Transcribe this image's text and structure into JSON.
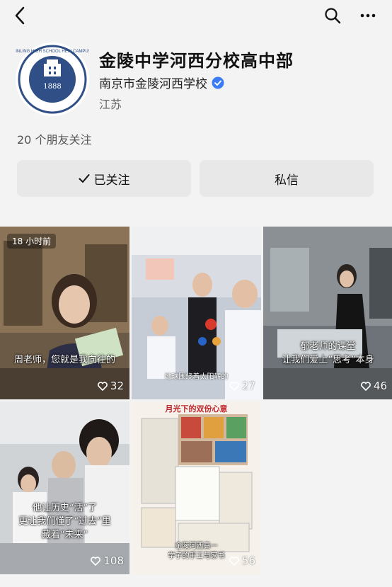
{
  "profile": {
    "name": "金陵中学河西分校高中部",
    "organization": "南京市金陵河西学校",
    "region": "江苏",
    "friends_following": "20 个朋友关注",
    "logo_text": "金陵中学"
  },
  "actions": {
    "follow_label": "已关注",
    "message_label": "私信"
  },
  "videos": [
    {
      "time": "18 小时前",
      "caption": "周老师，您就是我向往的",
      "likes": "32"
    },
    {
      "subcaption": "地球围绕着太阳转的",
      "likes": "27"
    },
    {
      "caption": "郁老师的课堂\n让我们爱上“思考”本身",
      "likes": "46"
    },
    {
      "caption": "他让历史“活”了\n更让我们懂了“过去”里\n藏着“未来”",
      "likes": "108"
    },
    {
      "top_caption": "月光下的双份心意",
      "caption": "金陵河西高一\n学子的手工与家书",
      "likes": "56"
    }
  ],
  "colors": {
    "logo_blue": "#2f4f86",
    "verified_blue": "#3b7cf6"
  }
}
